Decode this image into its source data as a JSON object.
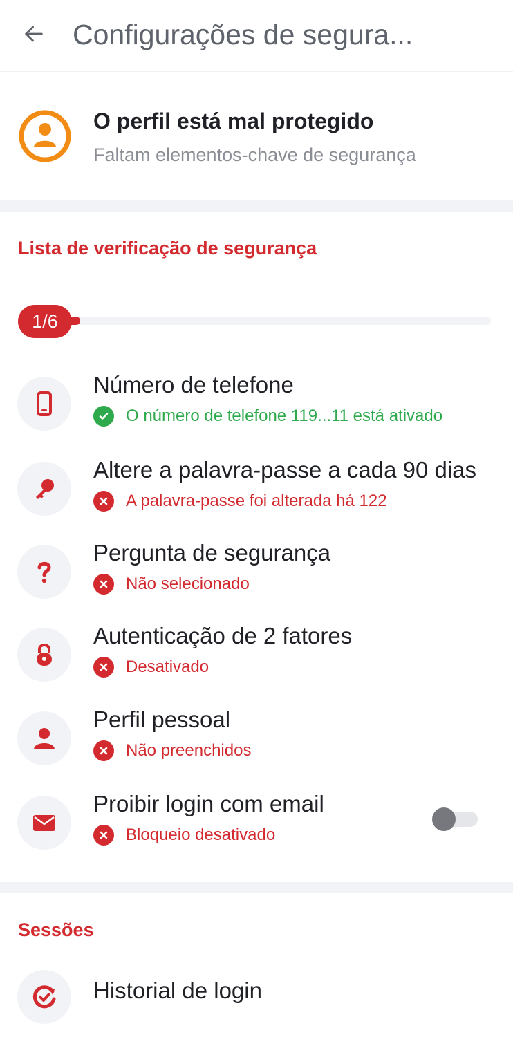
{
  "header": {
    "back_icon": "arrow-left-icon",
    "title": "Configurações de segura..."
  },
  "status": {
    "icon": "user-circle-icon",
    "color": "#f28c14",
    "title": "O perfil está mal protegido",
    "subtitle": "Faltam elementos-chave de segurança"
  },
  "checklist": {
    "title": "Lista de verificação de segurança",
    "progress_label": "1/6",
    "progress_completed": 1,
    "progress_total": 6,
    "items": [
      {
        "icon": "phone-icon",
        "title": "Número de telefone",
        "status": "ok",
        "status_text": "O número de telefone 119...11 está ativado"
      },
      {
        "icon": "key-icon",
        "title": "Altere a palavra-passe a cada 90 dias",
        "status": "bad",
        "status_text": "A palavra-passe foi alterada há 122"
      },
      {
        "icon": "question-mark-icon",
        "title": "Pergunta de segurança",
        "status": "bad",
        "status_text": "Não selecionado"
      },
      {
        "icon": "lock-icon",
        "title": "Autenticação de 2 fatores",
        "status": "bad",
        "status_text": "Desativado"
      },
      {
        "icon": "person-icon",
        "title": "Perfil pessoal",
        "status": "bad",
        "status_text": "Não preenchidos"
      },
      {
        "icon": "envelope-icon",
        "title": "Proibir login com email",
        "status": "bad",
        "status_text": "Bloqueio desativado",
        "toggle_on": false
      }
    ]
  },
  "sessions": {
    "title": "Sessões",
    "items": [
      {
        "icon": "history-icon",
        "title": "Historial de login"
      }
    ]
  },
  "colors": {
    "accent": "#d32a2f",
    "success": "#2eaa4c",
    "warning": "#f28c14"
  }
}
